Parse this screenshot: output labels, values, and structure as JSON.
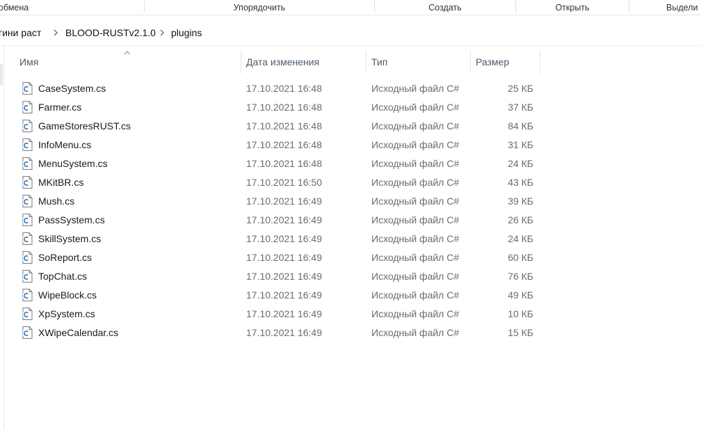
{
  "ribbon": {
    "groups": [
      "обмена",
      "Упорядочить",
      "Создать",
      "Открыть",
      "Выдели"
    ]
  },
  "breadcrumb": [
    "гини раст",
    "BLOOD-RUSTv2.1.0",
    "plugins"
  ],
  "columns": {
    "name": "Имя",
    "date": "Дата изменения",
    "type": "Тип",
    "size": "Размер"
  },
  "sort": {
    "column": "name",
    "direction": "ascending"
  },
  "files": [
    {
      "name": "CaseSystem.cs",
      "date": "17.10.2021 16:48",
      "type": "Исходный файл C#",
      "size": "25 КБ"
    },
    {
      "name": "Farmer.cs",
      "date": "17.10.2021 16:48",
      "type": "Исходный файл C#",
      "size": "37 КБ"
    },
    {
      "name": "GameStoresRUST.cs",
      "date": "17.10.2021 16:48",
      "type": "Исходный файл C#",
      "size": "84 КБ"
    },
    {
      "name": "InfoMenu.cs",
      "date": "17.10.2021 16:48",
      "type": "Исходный файл C#",
      "size": "31 КБ"
    },
    {
      "name": "MenuSystem.cs",
      "date": "17.10.2021 16:48",
      "type": "Исходный файл C#",
      "size": "24 КБ"
    },
    {
      "name": "MKitBR.cs",
      "date": "17.10.2021 16:50",
      "type": "Исходный файл C#",
      "size": "43 КБ"
    },
    {
      "name": "Mush.cs",
      "date": "17.10.2021 16:49",
      "type": "Исходный файл C#",
      "size": "39 КБ"
    },
    {
      "name": "PassSystem.cs",
      "date": "17.10.2021 16:49",
      "type": "Исходный файл C#",
      "size": "26 КБ"
    },
    {
      "name": "SkillSystem.cs",
      "date": "17.10.2021 16:49",
      "type": "Исходный файл C#",
      "size": "24 КБ"
    },
    {
      "name": "SoReport.cs",
      "date": "17.10.2021 16:49",
      "type": "Исходный файл C#",
      "size": "60 КБ"
    },
    {
      "name": "TopChat.cs",
      "date": "17.10.2021 16:49",
      "type": "Исходный файл C#",
      "size": "76 КБ"
    },
    {
      "name": "WipeBlock.cs",
      "date": "17.10.2021 16:49",
      "type": "Исходный файл C#",
      "size": "49 КБ"
    },
    {
      "name": "XpSystem.cs",
      "date": "17.10.2021 16:49",
      "type": "Исходный файл C#",
      "size": "10 КБ"
    },
    {
      "name": "XWipeCalendar.cs",
      "date": "17.10.2021 16:49",
      "type": "Исходный файл C#",
      "size": "15 КБ"
    }
  ],
  "icons": {
    "file": "csharp-file-icon",
    "breadcrumb_sep": "chevron-right-icon",
    "sort": "sort-up-icon"
  },
  "colors": {
    "header_text": "#4a5a6a",
    "secondary_text": "#6b6b6b",
    "icon_accent": "#2a6fb0"
  }
}
